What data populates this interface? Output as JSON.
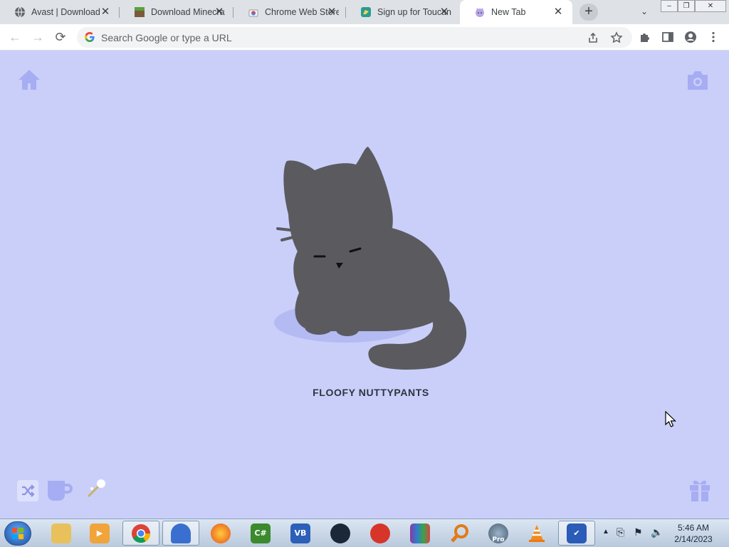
{
  "browser": {
    "tabs": [
      {
        "title": "Avast | Download",
        "favicon": "globe-icon",
        "active": false
      },
      {
        "title": "Download Minecraft",
        "favicon": "minecraft-grass-block-icon",
        "active": false
      },
      {
        "title": "Chrome Web Store",
        "favicon": "chrome-web-store-icon",
        "active": false
      },
      {
        "title": "Sign up for Toucan",
        "favicon": "toucan-icon",
        "active": false
      },
      {
        "title": "New Tab",
        "favicon": "cat-face-icon",
        "active": true
      }
    ],
    "new_tab_label": "+",
    "window_controls": {
      "minimize": "–",
      "restore": "❐",
      "close": "✕"
    }
  },
  "toolbar": {
    "omnibox_placeholder": "Search Google or type a URL"
  },
  "page": {
    "pet_name": "FLOOFY NUTTYPANTS",
    "colors": {
      "background": "#cacffa",
      "cat": "#5b5b5f",
      "shadow": "#b4baf2",
      "icon_tint": "#a6adf2"
    }
  },
  "taskbar": {
    "apps": [
      {
        "name": "file-explorer",
        "label": ""
      },
      {
        "name": "media-player",
        "label": ""
      },
      {
        "name": "chrome",
        "label": ""
      },
      {
        "name": "app-blue",
        "label": ""
      },
      {
        "name": "firefox",
        "label": ""
      },
      {
        "name": "csharp",
        "label": "C#"
      },
      {
        "name": "visual-basic",
        "label": "VB"
      },
      {
        "name": "steam",
        "label": ""
      },
      {
        "name": "ccleaner",
        "label": ""
      },
      {
        "name": "winrar",
        "label": ""
      },
      {
        "name": "search-tool",
        "label": ""
      },
      {
        "name": "google-earth-pro",
        "label": "Pro"
      },
      {
        "name": "vlc",
        "label": ""
      },
      {
        "name": "security-app",
        "label": ""
      }
    ],
    "clock_time": "5:46 AM",
    "clock_date": "2/14/2023"
  }
}
